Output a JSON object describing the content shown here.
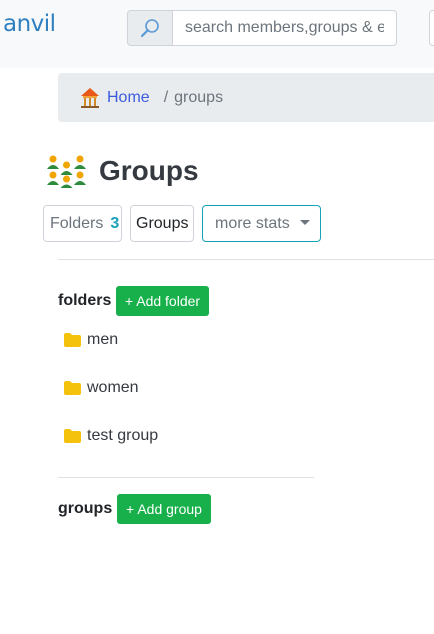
{
  "app": {
    "logo": "anvil"
  },
  "search": {
    "placeholder": "search members,groups & e"
  },
  "breadcrumb": {
    "home": "Home",
    "separator": "/",
    "current": "groups"
  },
  "page": {
    "title": "Groups"
  },
  "stats": {
    "folders_label": "Folders",
    "folders_count": "3",
    "groups_label": "Groups",
    "more_label": "more stats"
  },
  "folders_section": {
    "label": "folders",
    "add_button": "+ Add folder",
    "items": [
      {
        "label": "men"
      },
      {
        "label": "women"
      },
      {
        "label": "test group"
      }
    ]
  },
  "groups_section": {
    "label": "groups",
    "add_button": "+ Add group"
  },
  "colors": {
    "accent": "#17a2b8",
    "add_green": "#18b04a",
    "folder_yellow": "#f4c20d",
    "link_blue": "#3b5bdb"
  },
  "icons": {
    "search": "search-icon",
    "home": "temple-icon",
    "title": "people-group-icon",
    "folder": "folder-icon"
  }
}
